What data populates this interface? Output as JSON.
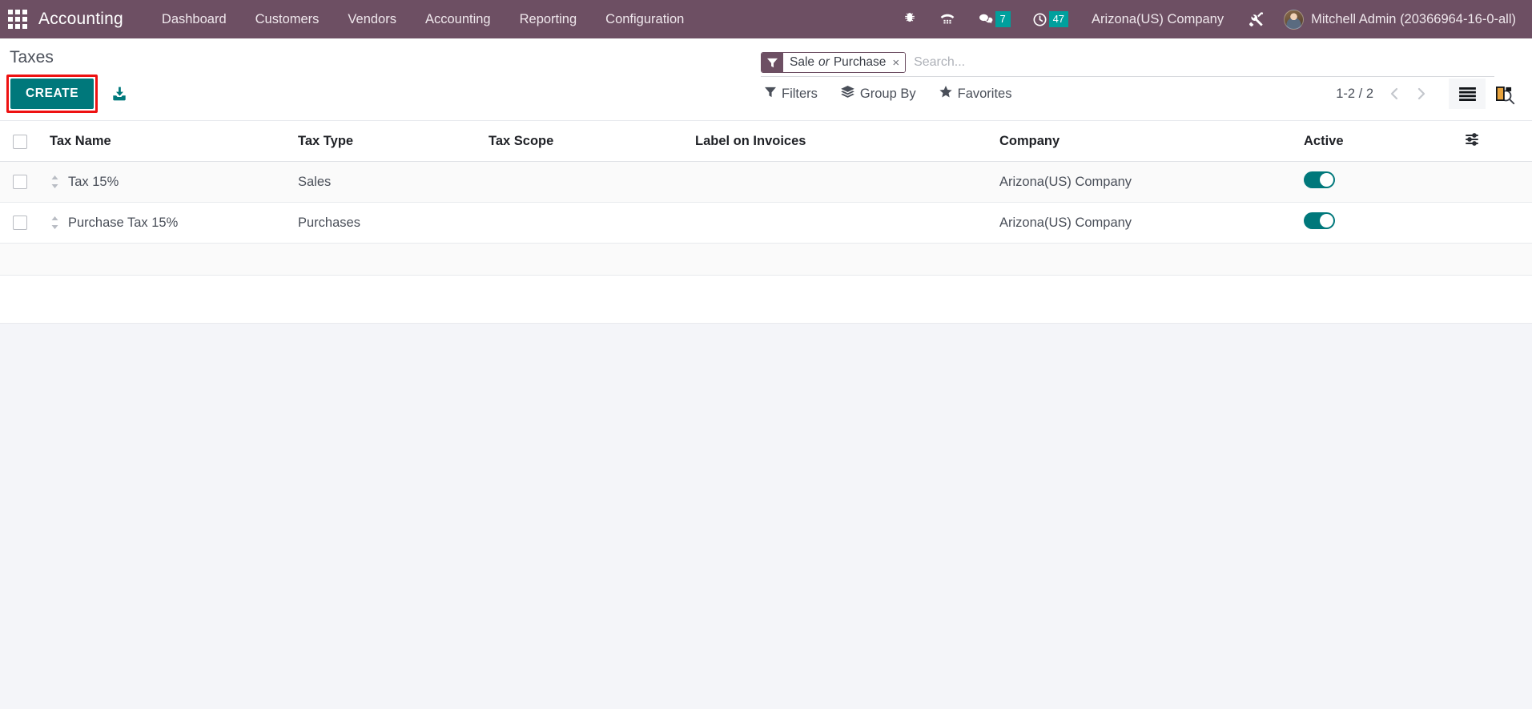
{
  "navbar": {
    "apps_icon": "apps-grid-icon",
    "brand": "Accounting",
    "menus": [
      "Dashboard",
      "Customers",
      "Vendors",
      "Accounting",
      "Reporting",
      "Configuration"
    ],
    "system_icons": [
      {
        "name": "bug-icon",
        "badge": null
      },
      {
        "name": "dialpad-icon",
        "badge": null
      },
      {
        "name": "messages-icon",
        "badge": "7"
      },
      {
        "name": "activities-clock-icon",
        "badge": "47"
      }
    ],
    "company": "Arizona(US) Company",
    "settings_icon": "tools-wrench-icon",
    "user": "Mitchell Admin (20366964-16-0-all)",
    "badge_color": "#00a09d",
    "background_color": "#6d4f63"
  },
  "control_panel": {
    "title": "Taxes",
    "create_label": "CREATE",
    "create_highlight_color": "#ee1111",
    "create_color": "#00787b",
    "import_icon": "import-icon",
    "search": {
      "facet": {
        "icon": "filter-funnel-icon",
        "prefix": "Sale",
        "conjunction": "or",
        "suffix": "Purchase",
        "remove": "×"
      },
      "placeholder": "Search...",
      "value": "",
      "search_icon": "search-icon"
    },
    "buttons": [
      {
        "label": "Filters",
        "icon": "filter-funnel-icon"
      },
      {
        "label": "Group By",
        "icon": "layers-icon"
      },
      {
        "label": "Favorites",
        "icon": "star-icon"
      }
    ],
    "pager": {
      "text": "1-2 / 2",
      "prev_icon": "chevron-left-icon",
      "next_icon": "chevron-right-icon"
    },
    "views": [
      {
        "name": "list-view",
        "icon": "list-icon",
        "active": true
      },
      {
        "name": "kanban-view",
        "icon": "kanban-icon",
        "active": false
      }
    ]
  },
  "list": {
    "columns": [
      "Tax Name",
      "Tax Type",
      "Tax Scope",
      "Label on Invoices",
      "Company",
      "Active"
    ],
    "options_icon": "column-options-icon",
    "rows": [
      {
        "tax_name": "Tax 15%",
        "tax_type": "Sales",
        "tax_scope": "",
        "label_on_invoices": "",
        "company": "Arizona(US) Company",
        "active": true
      },
      {
        "tax_name": "Purchase Tax 15%",
        "tax_type": "Purchases",
        "tax_scope": "",
        "label_on_invoices": "",
        "company": "Arizona(US) Company",
        "active": true
      }
    ],
    "toggle_on_color": "#00787b"
  }
}
